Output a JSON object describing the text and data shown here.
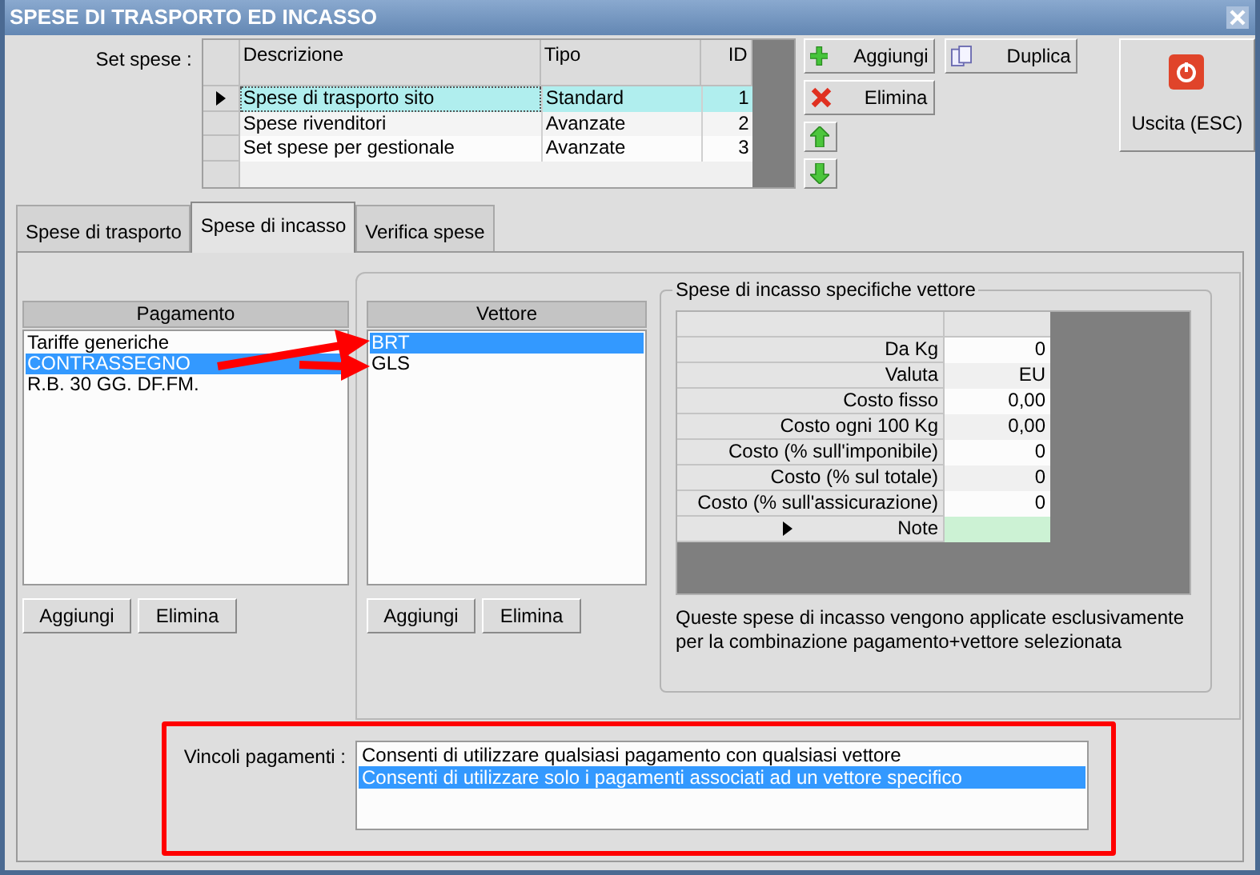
{
  "window": {
    "title": "SPESE DI TRASPORTO ED INCASSO"
  },
  "set_spese": {
    "label": "Set spese :",
    "columns": [
      "Descrizione",
      "Tipo",
      "ID"
    ],
    "rows": [
      {
        "descrizione": "Spese di trasporto sito",
        "tipo": "Standard",
        "id": "1",
        "selected": true
      },
      {
        "descrizione": "Spese rivenditori",
        "tipo": "Avanzate",
        "id": "2",
        "selected": false
      },
      {
        "descrizione": "Set spese per gestionale",
        "tipo": "Avanzate",
        "id": "3",
        "selected": false
      }
    ],
    "buttons": {
      "add": "Aggiungi",
      "duplicate": "Duplica",
      "delete": "Elimina"
    }
  },
  "exit_button": {
    "label": "Uscita (ESC)"
  },
  "tabs": [
    {
      "label": "Spese di trasporto",
      "selected": false
    },
    {
      "label": "Spese di incasso",
      "selected": true
    },
    {
      "label": "Verifica spese",
      "selected": false
    }
  ],
  "pagamento": {
    "header": "Pagamento",
    "items": [
      {
        "label": "Tariffe generiche",
        "selected": false
      },
      {
        "label": "CONTRASSEGNO",
        "selected": true
      },
      {
        "label": "R.B. 30 GG. DF.FM.",
        "selected": false
      }
    ],
    "buttons": [
      "Aggiungi",
      "Elimina"
    ]
  },
  "vettore": {
    "header": "Vettore",
    "items": [
      {
        "label": "BRT",
        "selected": true
      },
      {
        "label": "GLS",
        "selected": false
      }
    ],
    "buttons": [
      "Aggiungi",
      "Elimina"
    ]
  },
  "spese_vettore": {
    "title": "Spese di incasso specifiche vettore",
    "rows": [
      {
        "label": "Da Kg",
        "value": "0",
        "current": false
      },
      {
        "label": "Valuta",
        "value": "EU",
        "current": false
      },
      {
        "label": "Costo fisso",
        "value": "0,00",
        "current": false
      },
      {
        "label": "Costo ogni 100 Kg",
        "value": "0,00",
        "current": false
      },
      {
        "label": "Costo (% sull'imponibile)",
        "value": "0",
        "current": false
      },
      {
        "label": "Costo (% sul totale)",
        "value": "0",
        "current": false
      },
      {
        "label": "Costo (% sull'assicurazione)",
        "value": "0",
        "current": false
      },
      {
        "label": "Note",
        "current": true
      }
    ],
    "note": "Queste spese di incasso vengono applicate esclusivamente per la combinazione pagamento+vettore selezionata"
  },
  "vincoli": {
    "label": "Vincoli pagamenti :",
    "options": [
      {
        "label": "Consenti di utilizzare qualsiasi pagamento con qualsiasi vettore",
        "selected": false
      },
      {
        "label": "Consenti di utilizzare solo i pagamenti associati ad un vettore specifico",
        "selected": true
      }
    ]
  }
}
